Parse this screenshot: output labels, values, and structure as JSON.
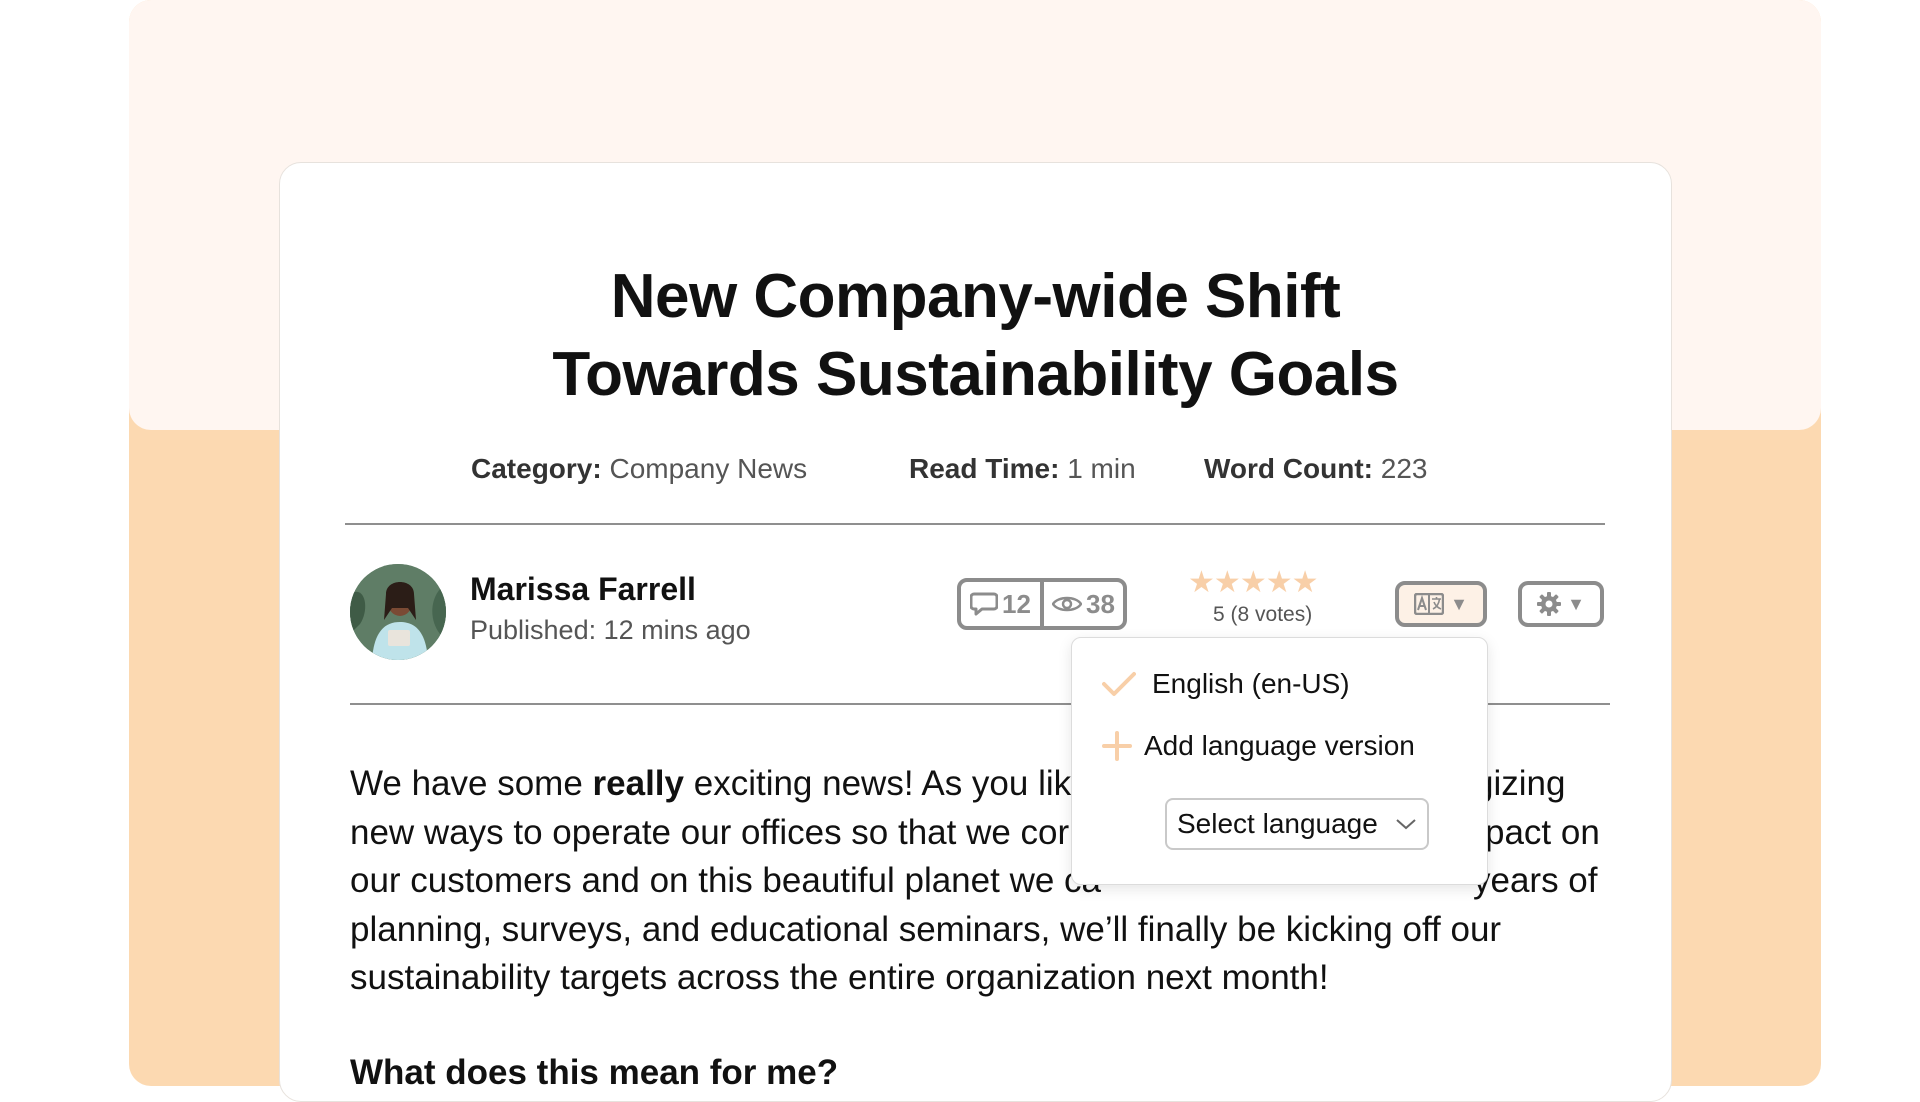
{
  "article": {
    "title_line1": "New Company-wide Shift",
    "title_line2": "Towards Sustainability Goals",
    "meta": {
      "category_label": "Category:",
      "category_value": "Company News",
      "read_time_label": "Read Time:",
      "read_time_value": "1 min",
      "word_count_label": "Word Count:",
      "word_count_value": "223"
    },
    "author": {
      "name": "Marissa Farrell",
      "published": "Published: 12 mins ago"
    },
    "stats": {
      "comments": "12",
      "views": "38"
    },
    "rating": {
      "stars": 5,
      "max_stars": 5,
      "text": "5 (8 votes)"
    },
    "body": {
      "p1_start": "We have some ",
      "p1_bold": "really",
      "p1_rest": " exciting news! As you lik",
      "p1_right_1": "gizing",
      "line2_left": "new ways to operate our offices so that we cor",
      "line2_right": "pact on",
      "line3_left": "our customers and on this beautiful planet we ca",
      "line3_right": "years of",
      "line4": "planning, surveys, and educational seminars, we’ll finally be kicking off our",
      "line5": "sustainability targets across the entire organization next month!",
      "subheading": "What does this mean for me?"
    }
  },
  "language_menu": {
    "current": "English (en-US)",
    "add": "Add language version",
    "select_placeholder": "Select language"
  },
  "colors": {
    "accent": "#f8cfa8",
    "frame_bg": "#fcd9b1",
    "frame_top_bg": "#fff6f1",
    "icon_gray": "#8c8c8c"
  },
  "icons": {
    "comments": "speech-bubble-icon",
    "views": "eye-icon",
    "language": "translate-icon",
    "settings": "gear-icon",
    "check": "check-icon",
    "add": "plus-icon",
    "select_chevron": "chevron-down-icon"
  }
}
